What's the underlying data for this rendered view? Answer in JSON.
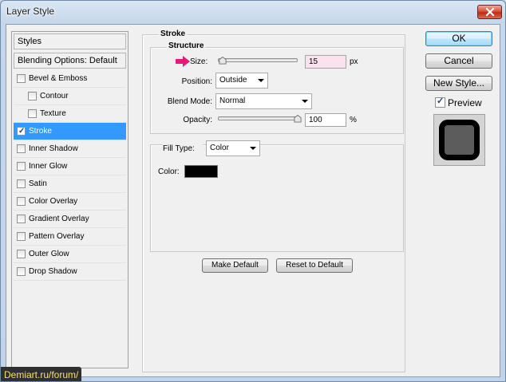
{
  "window": {
    "title": "Layer Style"
  },
  "styles_list": {
    "header": "Styles",
    "blending_options": "Blending Options: Default",
    "items": [
      {
        "label": "Bevel & Emboss",
        "checked": false,
        "indent": false,
        "selected": false
      },
      {
        "label": "Contour",
        "checked": false,
        "indent": true,
        "selected": false
      },
      {
        "label": "Texture",
        "checked": false,
        "indent": true,
        "selected": false
      },
      {
        "label": "Stroke",
        "checked": true,
        "indent": false,
        "selected": true
      },
      {
        "label": "Inner Shadow",
        "checked": false,
        "indent": false,
        "selected": false
      },
      {
        "label": "Inner Glow",
        "checked": false,
        "indent": false,
        "selected": false
      },
      {
        "label": "Satin",
        "checked": false,
        "indent": false,
        "selected": false
      },
      {
        "label": "Color Overlay",
        "checked": false,
        "indent": false,
        "selected": false
      },
      {
        "label": "Gradient Overlay",
        "checked": false,
        "indent": false,
        "selected": false
      },
      {
        "label": "Pattern Overlay",
        "checked": false,
        "indent": false,
        "selected": false
      },
      {
        "label": "Outer Glow",
        "checked": false,
        "indent": false,
        "selected": false
      },
      {
        "label": "Drop Shadow",
        "checked": false,
        "indent": false,
        "selected": false
      }
    ]
  },
  "stroke": {
    "title": "Stroke",
    "structure_title": "Structure",
    "size_label": "Size:",
    "size_value": "15",
    "size_unit": "px",
    "size_slider_fraction": 0.06,
    "position_label": "Position:",
    "position_value": "Outside",
    "blend_mode_label": "Blend Mode:",
    "blend_mode_value": "Normal",
    "opacity_label": "Opacity:",
    "opacity_value": "100",
    "opacity_unit": "%",
    "opacity_slider_fraction": 1.0,
    "fill_type_label": "Fill Type:",
    "fill_type_value": "Color",
    "color_label": "Color:",
    "color_value": "#000000",
    "make_default_label": "Make Default",
    "reset_default_label": "Reset to Default"
  },
  "buttons": {
    "ok": "OK",
    "cancel": "Cancel",
    "new_style": "New Style..."
  },
  "preview": {
    "label": "Preview",
    "checked": true
  },
  "watermark": "Demiart.ru/forum/",
  "colors": {
    "selection": "#3399ff",
    "arrow": "#e6197a",
    "size_field_bg": "#fbe3ee",
    "watermark_text": "#f3e26b"
  },
  "icons": {
    "close": "close-x-icon",
    "arrow": "pink-right-arrow-icon",
    "slider_thumb": "slider-thumb-icon",
    "dropdown": "chevron-down-icon"
  }
}
